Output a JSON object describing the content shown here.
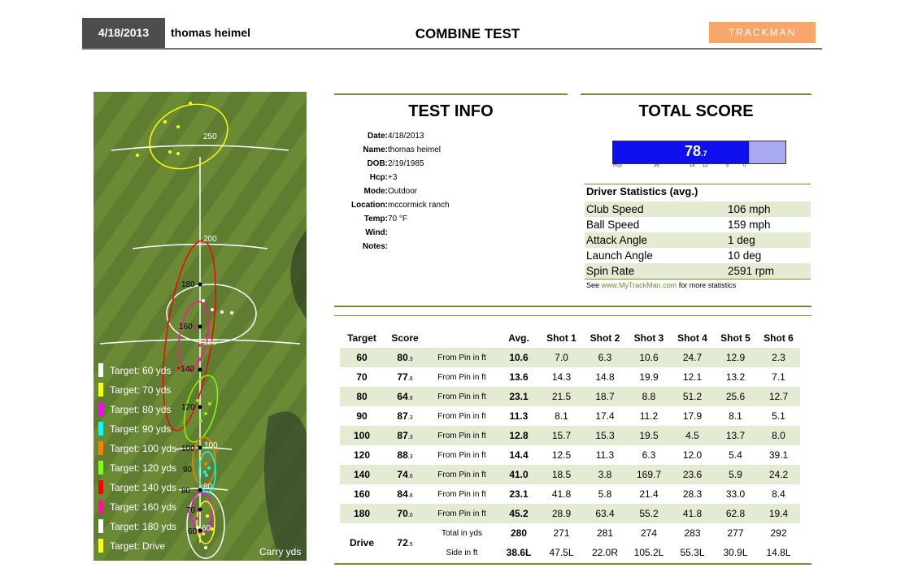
{
  "header": {
    "date": "4/18/2013",
    "name": "thomas heimel",
    "title": "COMBINE TEST",
    "logo": "TRACKMAN"
  },
  "test_info": {
    "title": "TEST INFO",
    "rows": [
      {
        "label": "Date:",
        "value": "4/18/2013"
      },
      {
        "label": "Name:",
        "value": "thomas heimel"
      },
      {
        "label": "DOB:",
        "value": "2/19/1985"
      },
      {
        "label": "Hcp:",
        "value": "+3"
      },
      {
        "label": "Mode:",
        "value": "Outdoor"
      },
      {
        "label": "Location:",
        "value": "mccormick ranch"
      },
      {
        "label": "Temp:",
        "value": "70 °F"
      },
      {
        "label": "Wind:",
        "value": ""
      },
      {
        "label": "Notes:",
        "value": ""
      }
    ]
  },
  "total_score": {
    "title": "TOTAL SCORE",
    "value_main": "78",
    "value_dec": ".7",
    "fill_fraction": 0.79,
    "scale_labels": [
      "Hcp",
      "36",
      "18",
      "12",
      "5",
      "0"
    ]
  },
  "driver_stats": {
    "title": "Driver Statistics (avg.)",
    "rows": [
      {
        "label": "Club Speed",
        "value": "106 mph"
      },
      {
        "label": "Ball Speed",
        "value": "159 mph"
      },
      {
        "label": "Attack Angle",
        "value": "1 deg"
      },
      {
        "label": "Launch Angle",
        "value": "10 deg"
      },
      {
        "label": "Spin Rate",
        "value": "2591 rpm"
      }
    ],
    "note_pre": "See ",
    "note_link": "www.MyTrackMan.com",
    "note_post": " for more statistics"
  },
  "table": {
    "headers": [
      "Target",
      "Score",
      "",
      "Avg.",
      "Shot 1",
      "Shot 2",
      "Shot 3",
      "Shot 4",
      "Shot 5",
      "Shot 6"
    ],
    "rows": [
      {
        "target": "60",
        "score": "80",
        "score_dec": ".3",
        "metric": "From Pin in ft",
        "avg": "10.6",
        "shots": [
          "7.0",
          "6.3",
          "10.6",
          "24.7",
          "12.9",
          "2.3"
        ]
      },
      {
        "target": "70",
        "score": "77",
        "score_dec": ".8",
        "metric": "From Pin in ft",
        "avg": "13.6",
        "shots": [
          "14.3",
          "14.8",
          "19.9",
          "12.1",
          "13.2",
          "7.1"
        ]
      },
      {
        "target": "80",
        "score": "64",
        "score_dec": ".6",
        "metric": "From Pin in ft",
        "avg": "23.1",
        "shots": [
          "21.5",
          "18.7",
          "8.8",
          "51.2",
          "25.6",
          "12.7"
        ]
      },
      {
        "target": "90",
        "score": "87",
        "score_dec": ".3",
        "metric": "From Pin in ft",
        "avg": "11.3",
        "shots": [
          "8.1",
          "17.4",
          "11.2",
          "17.9",
          "8.1",
          "5.1"
        ]
      },
      {
        "target": "100",
        "score": "87",
        "score_dec": ".3",
        "metric": "From Pin in ft",
        "avg": "12.8",
        "shots": [
          "15.7",
          "15.3",
          "19.5",
          "4.5",
          "13.7",
          "8.0"
        ]
      },
      {
        "target": "120",
        "score": "88",
        "score_dec": ".3",
        "metric": "From Pin in ft",
        "avg": "14.4",
        "shots": [
          "12.5",
          "11.3",
          "6.3",
          "12.0",
          "5.4",
          "39.1"
        ]
      },
      {
        "target": "140",
        "score": "74",
        "score_dec": ".6",
        "metric": "From Pin in ft",
        "avg": "41.0",
        "shots": [
          "18.5",
          "3.8",
          "169.7",
          "23.6",
          "5.9",
          "24.2"
        ]
      },
      {
        "target": "160",
        "score": "84",
        "score_dec": ".8",
        "metric": "From Pin in ft",
        "avg": "23.1",
        "shots": [
          "41.8",
          "5.8",
          "21.4",
          "28.3",
          "33.0",
          "8.4"
        ]
      },
      {
        "target": "180",
        "score": "70",
        "score_dec": ".0",
        "metric": "From Pin in ft",
        "avg": "45.2",
        "shots": [
          "28.9",
          "63.4",
          "55.2",
          "41.8",
          "62.8",
          "19.4"
        ]
      }
    ],
    "drive": {
      "target": "Drive",
      "score": "72",
      "score_dec": ".5",
      "total_label": "Total in yds",
      "total_avg": "280",
      "total_shots": [
        "271",
        "281",
        "274",
        "283",
        "277",
        "292"
      ],
      "side_label": "Side in ft",
      "side_avg": "38.6L",
      "side_shots": [
        "47.5L",
        "22.0R",
        "105.2L",
        "55.3L",
        "30.9L",
        "14.8L"
      ]
    }
  },
  "map": {
    "distance_labels": [
      "250",
      "200",
      "180",
      "160",
      "150",
      "140",
      "120",
      "100",
      "100",
      "90",
      "80",
      "80",
      "70",
      "60",
      "60"
    ],
    "carry_label": "Carry  yds",
    "legend": [
      {
        "label": "Target: 60 yds",
        "color": "#ffffff"
      },
      {
        "label": "Target: 70 yds",
        "color": "#ffff00"
      },
      {
        "label": "Target: 80 yds",
        "color": "#ff00ff"
      },
      {
        "label": "Target: 90 yds",
        "color": "#00ffff"
      },
      {
        "label": "Target: 100 yds",
        "color": "#ff7f00"
      },
      {
        "label": "Target: 120 yds",
        "color": "#7fff00"
      },
      {
        "label": "Target: 140 yds",
        "color": "#ff0000"
      },
      {
        "label": "Target: 160 yds",
        "color": "#ff1493"
      },
      {
        "label": "Target: 180 yds",
        "color": "#ffffff"
      },
      {
        "label": "Target: Drive",
        "color": "#ffff00"
      }
    ]
  }
}
